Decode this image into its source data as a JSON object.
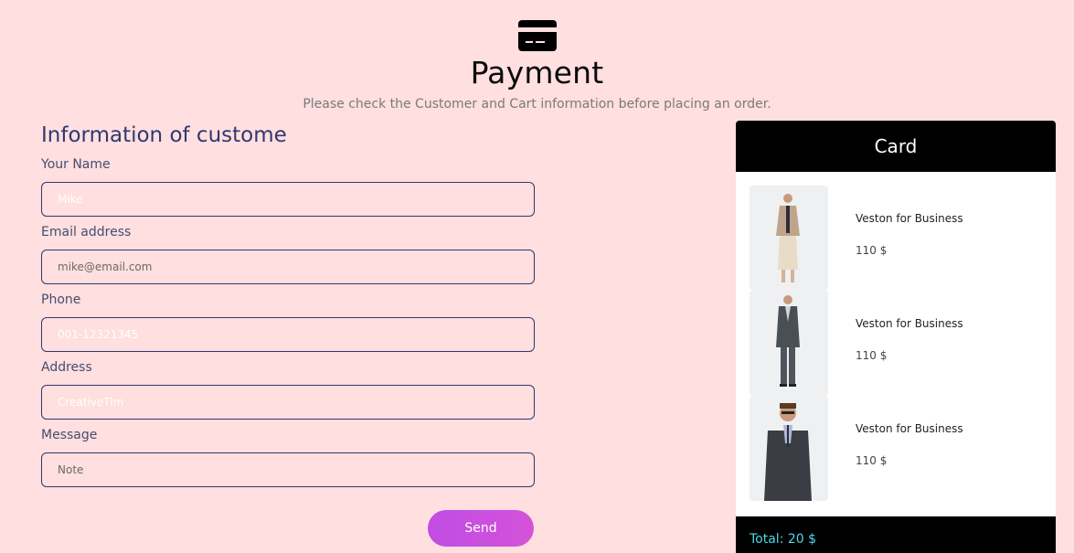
{
  "header": {
    "title": "Payment",
    "subtitle": "Please check the Customer and Cart information before placing an order."
  },
  "form": {
    "title": "Information of custome",
    "fields": [
      {
        "label": "Your Name",
        "value": "Mike",
        "placeholder": ""
      },
      {
        "label": "Email address",
        "value": "",
        "placeholder": "mike@email.com"
      },
      {
        "label": "Phone",
        "value": "001-12321345",
        "placeholder": ""
      },
      {
        "label": "Address",
        "value": "CreativeTim",
        "placeholder": ""
      },
      {
        "label": "Message",
        "value": "",
        "placeholder": "Note"
      }
    ],
    "send_label": "Send"
  },
  "cart": {
    "title": "Card",
    "items": [
      {
        "name": "Veston for Business",
        "price": "110 $"
      },
      {
        "name": "Veston for Business",
        "price": "110 $"
      },
      {
        "name": "Veston for Business",
        "price": "110 $"
      }
    ],
    "total": "Total: 20 $"
  },
  "colors": {
    "background": "#ffdfdf",
    "accent": "#2e3970",
    "send_gradient_start": "#c04de3",
    "send_gradient_end": "#d452d8",
    "total": "#49d9e6"
  }
}
